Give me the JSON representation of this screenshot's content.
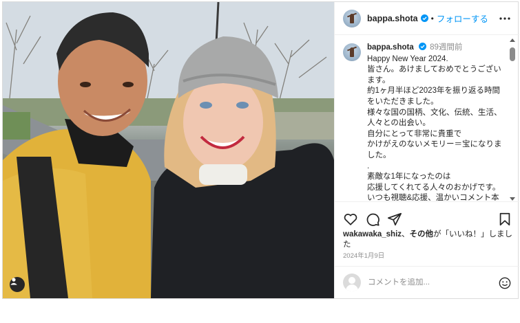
{
  "post": {
    "author": {
      "username": "bappa.shota",
      "verified": true
    },
    "header": {
      "separator": "•",
      "follow_label": "フォローする",
      "more_icon": "more-horizontal-icon"
    },
    "caption": {
      "username": "bappa.shota",
      "time_ago": "89週間前",
      "text": "Happy New Year 2024.\n皆さん。あけましておめでとうございます。\n約1ヶ月半ほど2023年を振り返る時間をいただきました。\n様々な国の国柄、文化、伝統、生活、人々との出会い。\n自分にとって非常に貴重で\nかけがえのないメモリー＝宝になりました。\n.\n素敵な1年になったのは\n応援してくれてる人々のおかげです。\nいつも視聴&応援、温かいコメント本当にありがとうございます。"
    },
    "actions": {
      "like_icon": "heart-icon",
      "comment_icon": "comment-icon",
      "share_icon": "send-icon",
      "save_icon": "bookmark-icon"
    },
    "likes": {
      "user": "wakawaka_shiz",
      "middle": "、",
      "others_label": "その他",
      "suffix": "が「いいね！」しました"
    },
    "date": "2024年1月9日",
    "comment": {
      "placeholder": "コメントを追加...",
      "emoji_icon": "emoji-icon"
    },
    "user_tag_icon": "user-tag-icon",
    "colors": {
      "link_blue": "#0095f6",
      "verified_blue": "#0095f6",
      "text": "#262626",
      "muted": "#8e8e8e",
      "border": "#dbdbdb"
    }
  }
}
